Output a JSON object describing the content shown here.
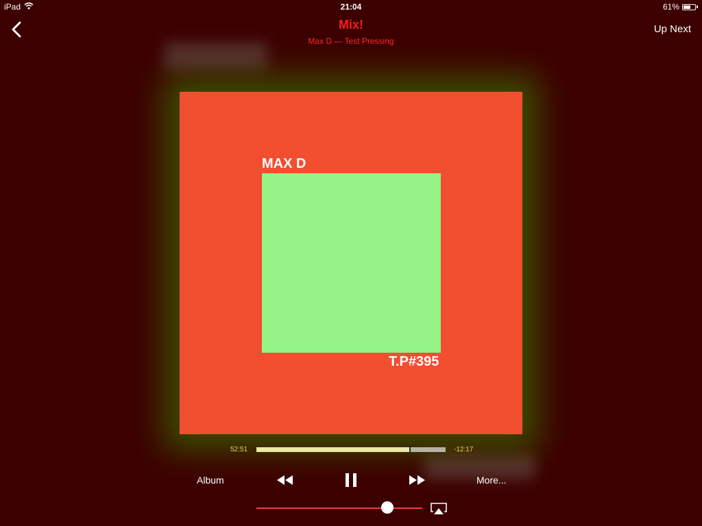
{
  "status_bar": {
    "device": "iPad",
    "time": "21:04",
    "battery": "61%",
    "battery_level": 0.61,
    "icons": [
      "wifi-icon",
      "battery-icon"
    ]
  },
  "header": {
    "back_icon": "chevron-left-icon",
    "title": "Mix!",
    "subtitle": "Max D — Test Pressing",
    "up_next_label": "Up Next"
  },
  "artwork": {
    "top_text": "MAX D",
    "bottom_text": "T.P#395",
    "colors": {
      "outer": "#f24e30",
      "inner": "#95f387"
    }
  },
  "progress": {
    "elapsed": "52:51",
    "remaining": "-12:17",
    "fraction": 0.81
  },
  "controls": {
    "album_label": "Album",
    "more_label": "More...",
    "icons": [
      "rewind-icon",
      "pause-icon",
      "fast-forward-icon"
    ]
  },
  "volume": {
    "level": 0.79,
    "airplay_icon": "airplay-icon"
  },
  "colors": {
    "background": "#3c0000",
    "title": "#ff1a1a",
    "time_text": "#e9d25a"
  }
}
